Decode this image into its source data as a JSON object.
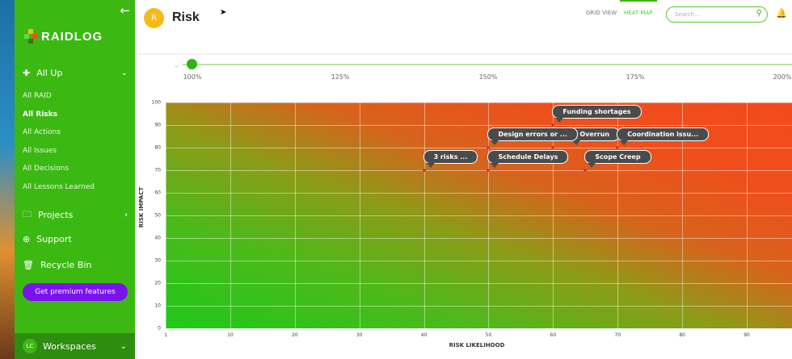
{
  "sidebar": {
    "brand": "RAIDLOG",
    "all_up": "All Up",
    "sub_items": [
      {
        "label": "All RAID"
      },
      {
        "label": "All Risks",
        "active": true
      },
      {
        "label": "All Actions"
      },
      {
        "label": "All Issues"
      },
      {
        "label": "All Decisions"
      },
      {
        "label": "All Lessons Learned"
      }
    ],
    "projects": "Projects",
    "support": "Support",
    "recycle_bin": "Recycle Bin",
    "premium": "Get premium features",
    "workspace_initials": "LC",
    "workspaces": "Workspaces",
    "colors": {
      "bg": "#3cb813",
      "premium": "#7a12f0"
    }
  },
  "header": {
    "avatar_letter": "R",
    "title": "Risk",
    "views": [
      "GRID VIEW",
      "HEAT MAP"
    ],
    "active_view": "HEAT MAP",
    "search_placeholder": "Search...",
    "bell_icon": "bell-icon"
  },
  "zoom": {
    "value": "100%",
    "labels": [
      "100%",
      "125%",
      "150%",
      "175%",
      "200%"
    ]
  },
  "chart_data": {
    "type": "scatter",
    "xlabel": "RISK LIKELIHOOD",
    "ylabel": "RISK IMPACT",
    "xlim": [
      0,
      97
    ],
    "ylim": [
      0,
      100
    ],
    "x_ticks": [
      "1",
      "10",
      "20",
      "30",
      "40",
      "50",
      "60",
      "70",
      "80",
      "90"
    ],
    "y_ticks": [
      "0",
      "10",
      "20",
      "30",
      "40",
      "50",
      "60",
      "70",
      "80",
      "90",
      "100"
    ],
    "grid": true,
    "points": [
      {
        "label": "Funding shortages",
        "x": 60,
        "y": 90
      },
      {
        "label": "Design errors or ...",
        "x": 50,
        "y": 80
      },
      {
        "label": "Overrun",
        "x": 60,
        "y": 80
      },
      {
        "label": "Coordination issu...",
        "x": 70,
        "y": 80
      },
      {
        "label": "3 risks ...",
        "x": 40,
        "y": 70
      },
      {
        "label": "Schedule Delays",
        "x": 50,
        "y": 70
      },
      {
        "label": "Scope Creep",
        "x": 65,
        "y": 70
      }
    ]
  }
}
